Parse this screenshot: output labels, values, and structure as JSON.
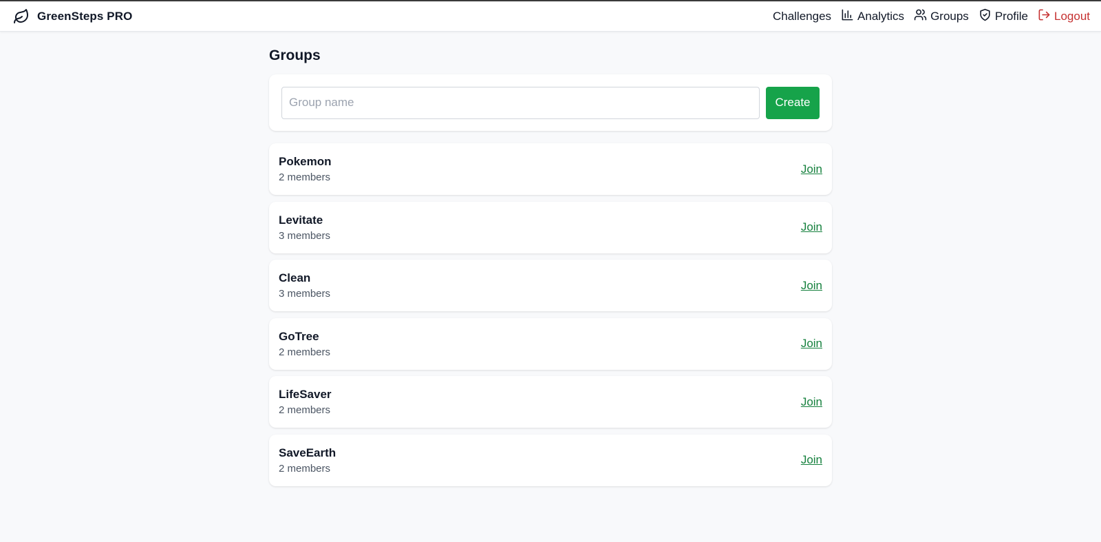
{
  "nav": {
    "brand": "GreenSteps PRO",
    "brand_icon": "leaf-icon",
    "links": [
      {
        "label": "Challenges",
        "icon": ""
      },
      {
        "label": "Analytics",
        "icon": "bar-chart-icon"
      },
      {
        "label": "Groups",
        "icon": "users-icon"
      },
      {
        "label": "Profile",
        "icon": "shield-icon"
      },
      {
        "label": "Logout",
        "icon": "logout-icon"
      }
    ]
  },
  "page": {
    "title": "Groups"
  },
  "create": {
    "placeholder": "Group name",
    "value": "",
    "button_label": "Create"
  },
  "groups": [
    {
      "name": "Pokemon",
      "members": "2 members",
      "action": "Join"
    },
    {
      "name": "Levitate",
      "members": "3 members",
      "action": "Join"
    },
    {
      "name": "Clean",
      "members": "3 members",
      "action": "Join"
    },
    {
      "name": "GoTree",
      "members": "2 members",
      "action": "Join"
    },
    {
      "name": "LifeSaver",
      "members": "2 members",
      "action": "Join"
    },
    {
      "name": "SaveEarth",
      "members": "2 members",
      "action": "Join"
    }
  ],
  "colors": {
    "accent": "#16a34a",
    "link": "#15803d",
    "logout": "#c53030",
    "background": "#f8f9fb"
  }
}
